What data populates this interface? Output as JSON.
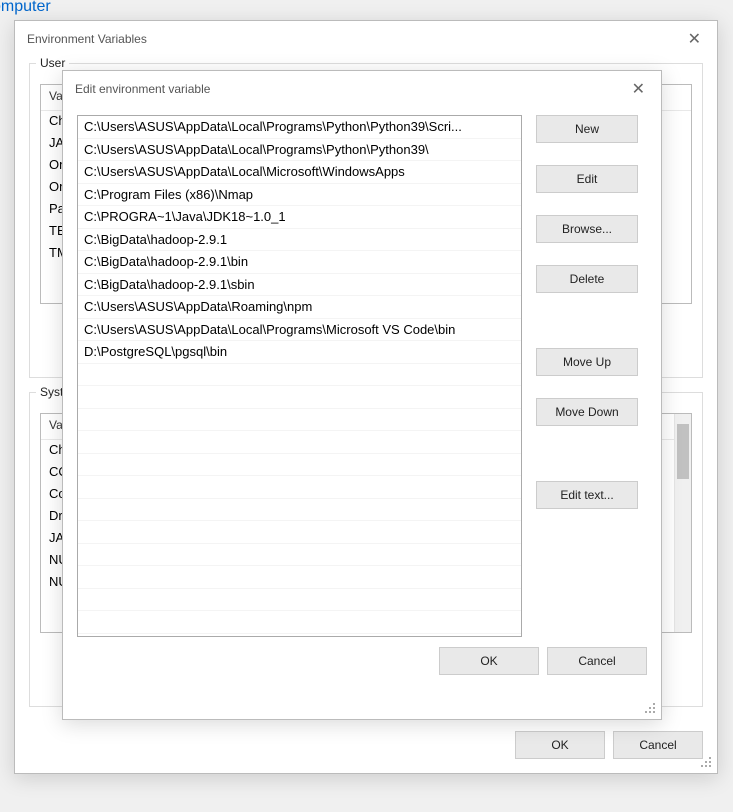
{
  "breadcrumb_fragment": "omputer",
  "env_dialog": {
    "title": "Environment Variables",
    "user_group_label": "User",
    "user_vars_header_variable": "Va",
    "user_vars_rows": [
      "Ch",
      "JA",
      "On",
      "On",
      "Pa",
      "TE",
      "TM"
    ],
    "system_group_label": "Syste",
    "system_vars_header_variable": "Va",
    "system_vars_rows": [
      "Ch",
      "CO",
      "Co",
      "Dr",
      "JA",
      "NU",
      "NU"
    ],
    "buttons": {
      "ok": "OK",
      "cancel": "Cancel"
    }
  },
  "edit_dialog": {
    "title": "Edit environment variable",
    "paths": [
      "C:\\Users\\ASUS\\AppData\\Local\\Programs\\Python\\Python39\\Scri...",
      "C:\\Users\\ASUS\\AppData\\Local\\Programs\\Python\\Python39\\",
      "C:\\Users\\ASUS\\AppData\\Local\\Microsoft\\WindowsApps",
      "C:\\Program Files (x86)\\Nmap",
      "C:\\PROGRA~1\\Java\\JDK18~1.0_1",
      "C:\\BigData\\hadoop-2.9.1",
      "C:\\BigData\\hadoop-2.9.1\\bin",
      "C:\\BigData\\hadoop-2.9.1\\sbin",
      "C:\\Users\\ASUS\\AppData\\Roaming\\npm",
      "C:\\Users\\ASUS\\AppData\\Local\\Programs\\Microsoft VS Code\\bin",
      "D:\\PostgreSQL\\pgsql\\bin"
    ],
    "buttons": {
      "new": "New",
      "edit": "Edit",
      "browse": "Browse...",
      "delete": "Delete",
      "move_up": "Move Up",
      "move_down": "Move Down",
      "edit_text": "Edit text...",
      "ok": "OK",
      "cancel": "Cancel"
    }
  }
}
